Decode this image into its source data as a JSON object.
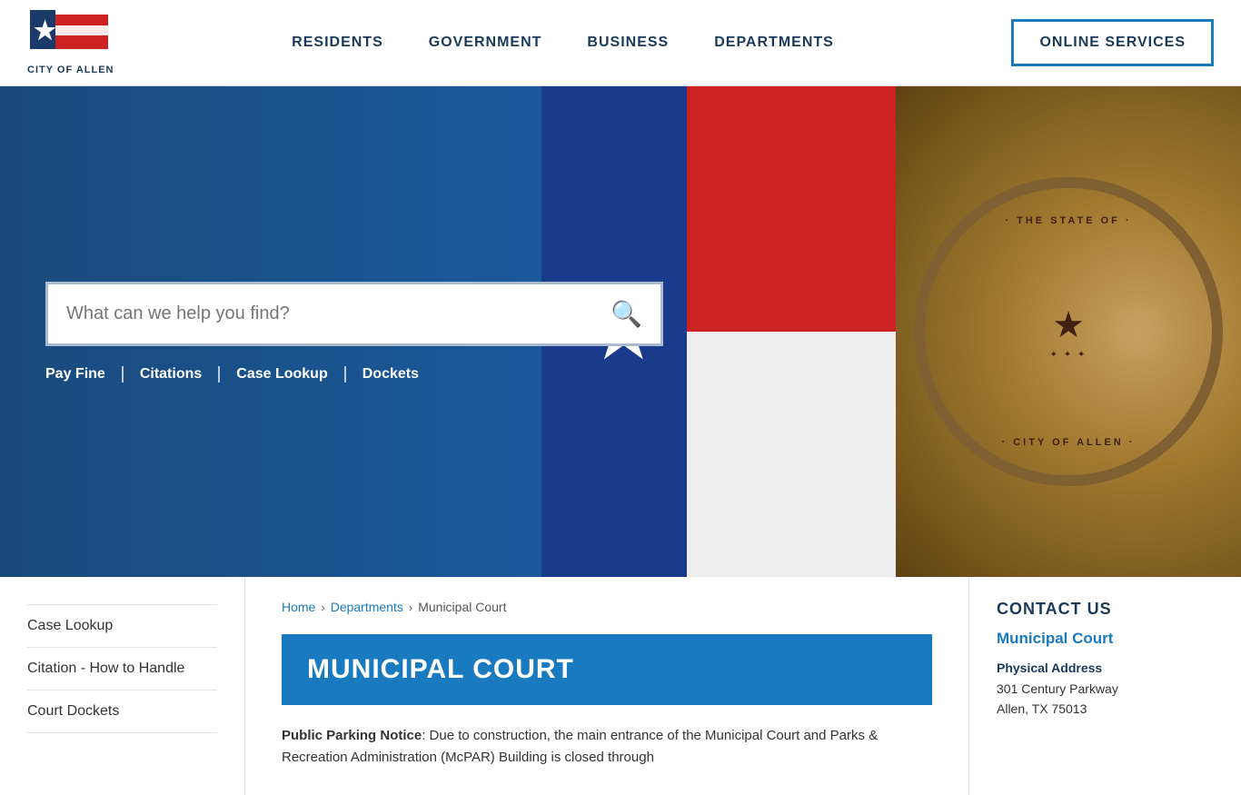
{
  "header": {
    "logo_text": "CITY OF ALLEN",
    "nav": [
      {
        "label": "RESIDENTS",
        "id": "residents"
      },
      {
        "label": "GOVERNMENT",
        "id": "government"
      },
      {
        "label": "BUSINESS",
        "id": "business"
      },
      {
        "label": "DEPARTMENTS",
        "id": "departments"
      }
    ],
    "online_services_label": "ONLINE SERVICES"
  },
  "hero": {
    "search_placeholder": "What can we help you find?",
    "quick_links": [
      {
        "label": "Pay Fine",
        "id": "pay-fine"
      },
      {
        "label": "Citations",
        "id": "citations"
      },
      {
        "label": "Case Lookup",
        "id": "case-lookup"
      },
      {
        "label": "Dockets",
        "id": "dockets"
      }
    ]
  },
  "sidebar": {
    "items": [
      {
        "label": "Case Lookup",
        "id": "case-lookup"
      },
      {
        "label": "Citation - How to Handle",
        "id": "citation-handle"
      },
      {
        "label": "Court Dockets",
        "id": "court-dockets"
      }
    ]
  },
  "breadcrumb": {
    "home": "Home",
    "departments": "Departments",
    "current": "Municipal Court",
    "sep": "›"
  },
  "page": {
    "title": "MUNICIPAL COURT",
    "content_bold": "Public Parking Notice",
    "content_text": ": Due to construction, the main entrance of the Municipal Court and Parks & Recreation Administration (McPAR) Building is closed through"
  },
  "contact": {
    "section_title": "CONTACT US",
    "dept_name": "Municipal Court",
    "address_label": "Physical Address",
    "address_line1": "301 Century Parkway",
    "address_line2": "Allen, TX 75013"
  }
}
